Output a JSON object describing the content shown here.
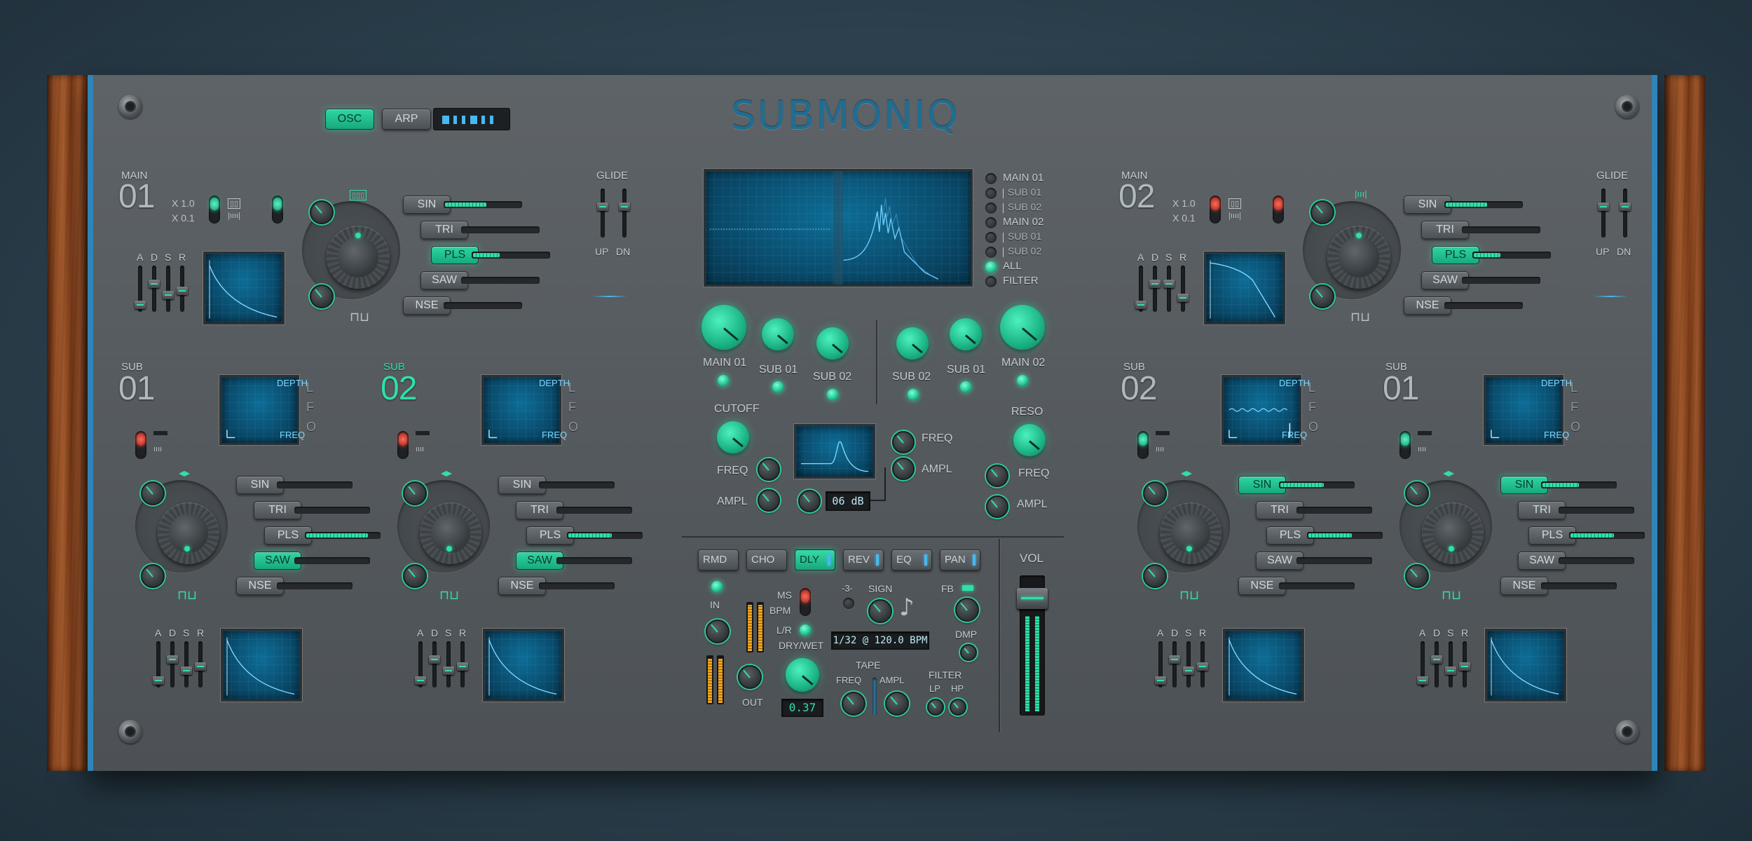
{
  "app": {
    "title": "SUBMONIQ"
  },
  "top_buttons": {
    "osc": "OSC",
    "arp": "ARP"
  },
  "main01": {
    "section": "MAIN",
    "number": "01",
    "mult_a": "X 1.0",
    "mult_b": "X 0.1",
    "adsr": [
      "A",
      "D",
      "S",
      "R"
    ],
    "glide": "GLIDE",
    "glide_up": "UP",
    "glide_dn": "DN",
    "waves": [
      {
        "label": "SIN",
        "level": 0.55,
        "on": false
      },
      {
        "label": "TRI",
        "level": 0.0,
        "on": false
      },
      {
        "label": "PLS",
        "level": 0.35,
        "on": true
      },
      {
        "label": "SAW",
        "level": 0.0,
        "on": false
      },
      {
        "label": "NSE",
        "level": 0.0,
        "on": false
      }
    ]
  },
  "main02": {
    "section": "MAIN",
    "number": "02",
    "mult_a": "X 1.0",
    "mult_b": "X 0.1",
    "adsr": [
      "A",
      "D",
      "S",
      "R"
    ],
    "glide": "GLIDE",
    "glide_up": "UP",
    "glide_dn": "DN",
    "waves": [
      {
        "label": "SIN",
        "level": 0.55,
        "on": false
      },
      {
        "label": "TRI",
        "level": 0.0,
        "on": false
      },
      {
        "label": "PLS",
        "level": 0.35,
        "on": true
      },
      {
        "label": "SAW",
        "level": 0.0,
        "on": false
      },
      {
        "label": "NSE",
        "level": 0.0,
        "on": false
      }
    ]
  },
  "subs": [
    {
      "section": "SUB",
      "number": "01",
      "depth": "DEPTH",
      "freq": "FREQ",
      "lfo": [
        "L",
        "F",
        "O"
      ],
      "adsr": [
        "A",
        "D",
        "S",
        "R"
      ],
      "waves": [
        {
          "label": "SIN",
          "on": false,
          "level": 0
        },
        {
          "label": "TRI",
          "on": false,
          "level": 0
        },
        {
          "label": "PLS",
          "on": false,
          "level": 0.85
        },
        {
          "label": "SAW",
          "on": true,
          "level": 0
        },
        {
          "label": "NSE",
          "on": false,
          "level": 0
        }
      ]
    },
    {
      "section": "SUB",
      "number": "02",
      "depth": "DEPTH",
      "freq": "FREQ",
      "lfo": [
        "L",
        "F",
        "O"
      ],
      "adsr": [
        "A",
        "D",
        "S",
        "R"
      ],
      "waves": [
        {
          "label": "SIN",
          "on": false,
          "level": 0
        },
        {
          "label": "TRI",
          "on": false,
          "level": 0
        },
        {
          "label": "PLS",
          "on": false,
          "level": 0.6
        },
        {
          "label": "SAW",
          "on": true,
          "level": 0
        },
        {
          "label": "NSE",
          "on": false,
          "level": 0
        }
      ]
    },
    {
      "section": "SUB",
      "number": "02",
      "depth": "DEPTH",
      "freq": "FREQ",
      "lfo": [
        "L",
        "F",
        "O"
      ],
      "adsr": [
        "A",
        "D",
        "S",
        "R"
      ],
      "waves": [
        {
          "label": "SIN",
          "on": true,
          "level": 0.6
        },
        {
          "label": "TRI",
          "on": false,
          "level": 0
        },
        {
          "label": "PLS",
          "on": false,
          "level": 0.6
        },
        {
          "label": "SAW",
          "on": false,
          "level": 0
        },
        {
          "label": "NSE",
          "on": false,
          "level": 0
        }
      ]
    },
    {
      "section": "SUB",
      "number": "01",
      "depth": "DEPTH",
      "freq": "FREQ",
      "lfo": [
        "L",
        "F",
        "O"
      ],
      "adsr": [
        "A",
        "D",
        "S",
        "R"
      ],
      "waves": [
        {
          "label": "SIN",
          "on": true,
          "level": 0.5
        },
        {
          "label": "TRI",
          "on": false,
          "level": 0
        },
        {
          "label": "PLS",
          "on": false,
          "level": 0.6
        },
        {
          "label": "SAW",
          "on": false,
          "level": 0
        },
        {
          "label": "NSE",
          "on": false,
          "level": 0
        }
      ]
    }
  ],
  "scope_list": [
    {
      "label": "MAIN 01",
      "sub": false,
      "on": false
    },
    {
      "label": "SUB 01",
      "sub": true,
      "on": false
    },
    {
      "label": "SUB 02",
      "sub": true,
      "on": false
    },
    {
      "label": "MAIN 02",
      "sub": false,
      "on": false
    },
    {
      "label": "SUB 01",
      "sub": true,
      "on": false
    },
    {
      "label": "SUB 02",
      "sub": true,
      "on": false
    },
    {
      "label": "ALL",
      "sub": false,
      "on": true
    },
    {
      "label": "FILTER",
      "sub": false,
      "on": false
    }
  ],
  "mixer": {
    "left": [
      "MAIN 01",
      "SUB 01",
      "SUB 02"
    ],
    "right": [
      "SUB 02",
      "SUB 01",
      "MAIN 02"
    ]
  },
  "filter": {
    "cutoff": "CUTOFF",
    "reso": "RESO",
    "freq": "FREQ",
    "ampl": "AMPL",
    "db": "06 dB"
  },
  "fx": {
    "tabs": [
      {
        "label": "RMD",
        "on": false,
        "ind": false
      },
      {
        "label": "CHO",
        "on": false,
        "ind": false
      },
      {
        "label": "DLY",
        "on": true,
        "ind": true
      },
      {
        "label": "REV",
        "on": false,
        "ind": true
      },
      {
        "label": "EQ",
        "on": false,
        "ind": true
      },
      {
        "label": "PAN",
        "on": false,
        "ind": true
      }
    ],
    "in": "IN",
    "out": "OUT",
    "ms": "MS",
    "bpm": "BPM",
    "lr": "L/R",
    "drywet": "DRY/WET",
    "drywet_value": "0.37",
    "minus3": "-3-",
    "sign": "SIGN",
    "fb": "FB",
    "dmp": "DMP",
    "sync": "1/32 @ 120.0 BPM",
    "tape": "TAPE",
    "tape_freq": "FREQ",
    "tape_ampl": "AMPL",
    "filter": "FILTER",
    "lp": "LP",
    "hp": "HP"
  },
  "vol": {
    "label": "VOL"
  }
}
